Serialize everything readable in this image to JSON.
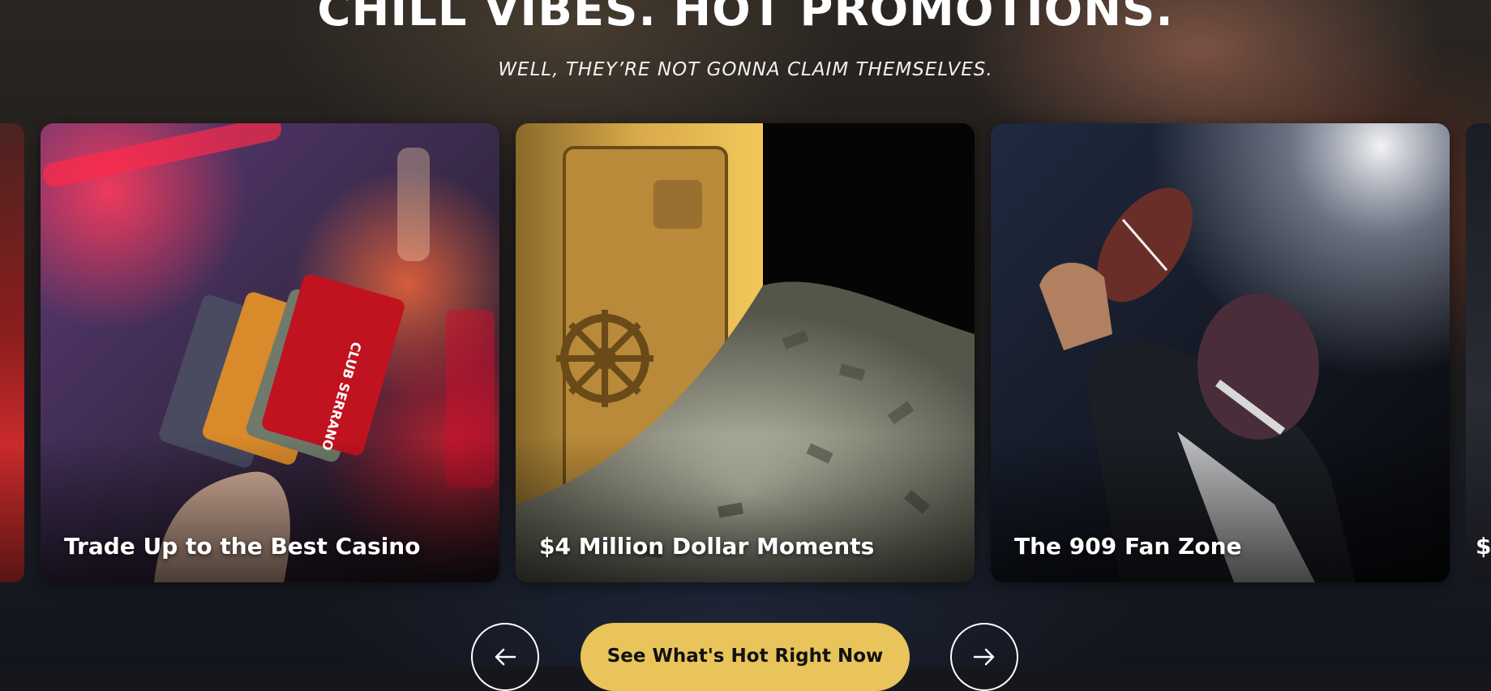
{
  "hero": {
    "headline": "CHILL VIBES. HOT PROMOTIONS.",
    "subheadline": "WELL, THEY’RE NOT GONNA CLAIM THEMSELVES."
  },
  "carousel": {
    "cards": [
      {
        "title": "Trade Up to the Best Casino",
        "image": "players-club-cards-photo"
      },
      {
        "title": "$4 Million Dollar Moments",
        "image": "vault-and-cash-photo"
      },
      {
        "title": "The 909 Fan Zone",
        "image": "football-quarterback-photo"
      }
    ],
    "next_card_peek": "$",
    "prev_icon": "arrow-left-icon",
    "next_icon": "arrow-right-icon"
  },
  "cta": {
    "label": "See What's Hot Right Now"
  },
  "colors": {
    "accent": "#e8c45a",
    "text": "#ffffff",
    "background": "#15171d"
  }
}
